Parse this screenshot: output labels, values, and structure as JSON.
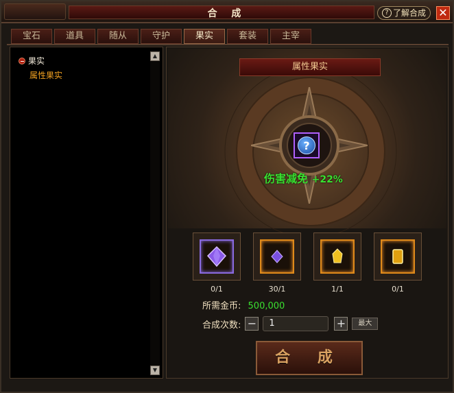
{
  "window": {
    "title": "合 成",
    "help_label": "了解合成",
    "help_glyph": "?",
    "close_glyph": "✕"
  },
  "tabs": [
    {
      "label": "宝石",
      "active": false
    },
    {
      "label": "道具",
      "active": false
    },
    {
      "label": "随从",
      "active": false
    },
    {
      "label": "守护",
      "active": false
    },
    {
      "label": "果实",
      "active": true
    },
    {
      "label": "套装",
      "active": false
    },
    {
      "label": "主宰",
      "active": false
    }
  ],
  "tree": {
    "root_label": "果实",
    "child_label": "属性果实"
  },
  "scroll": {
    "up_glyph": "▲",
    "down_glyph": "▼"
  },
  "preview": {
    "banner": "属性果实",
    "target_glyph": "?",
    "attribute_name": "伤害减免",
    "attribute_value": "+22%"
  },
  "materials": [
    {
      "icon": "purple-crystal-icon",
      "count": "0/1",
      "frame": "purple"
    },
    {
      "icon": "small-purple-gem-icon",
      "count": "30/1",
      "frame": "gold"
    },
    {
      "icon": "yellow-gem-icon",
      "count": "1/1",
      "frame": "gold"
    },
    {
      "icon": "gold-bar-icon",
      "count": "0/1",
      "frame": "gold"
    }
  ],
  "gold": {
    "label": "所需金币:",
    "amount": "500,000"
  },
  "count": {
    "label": "合成次数:",
    "minus": "−",
    "value": "1",
    "plus": "+",
    "max_label": "最大"
  },
  "craft_button": "合 成",
  "colors": {
    "green": "#3ae030",
    "orange": "#f0a020",
    "accent_red": "#c02a10"
  }
}
